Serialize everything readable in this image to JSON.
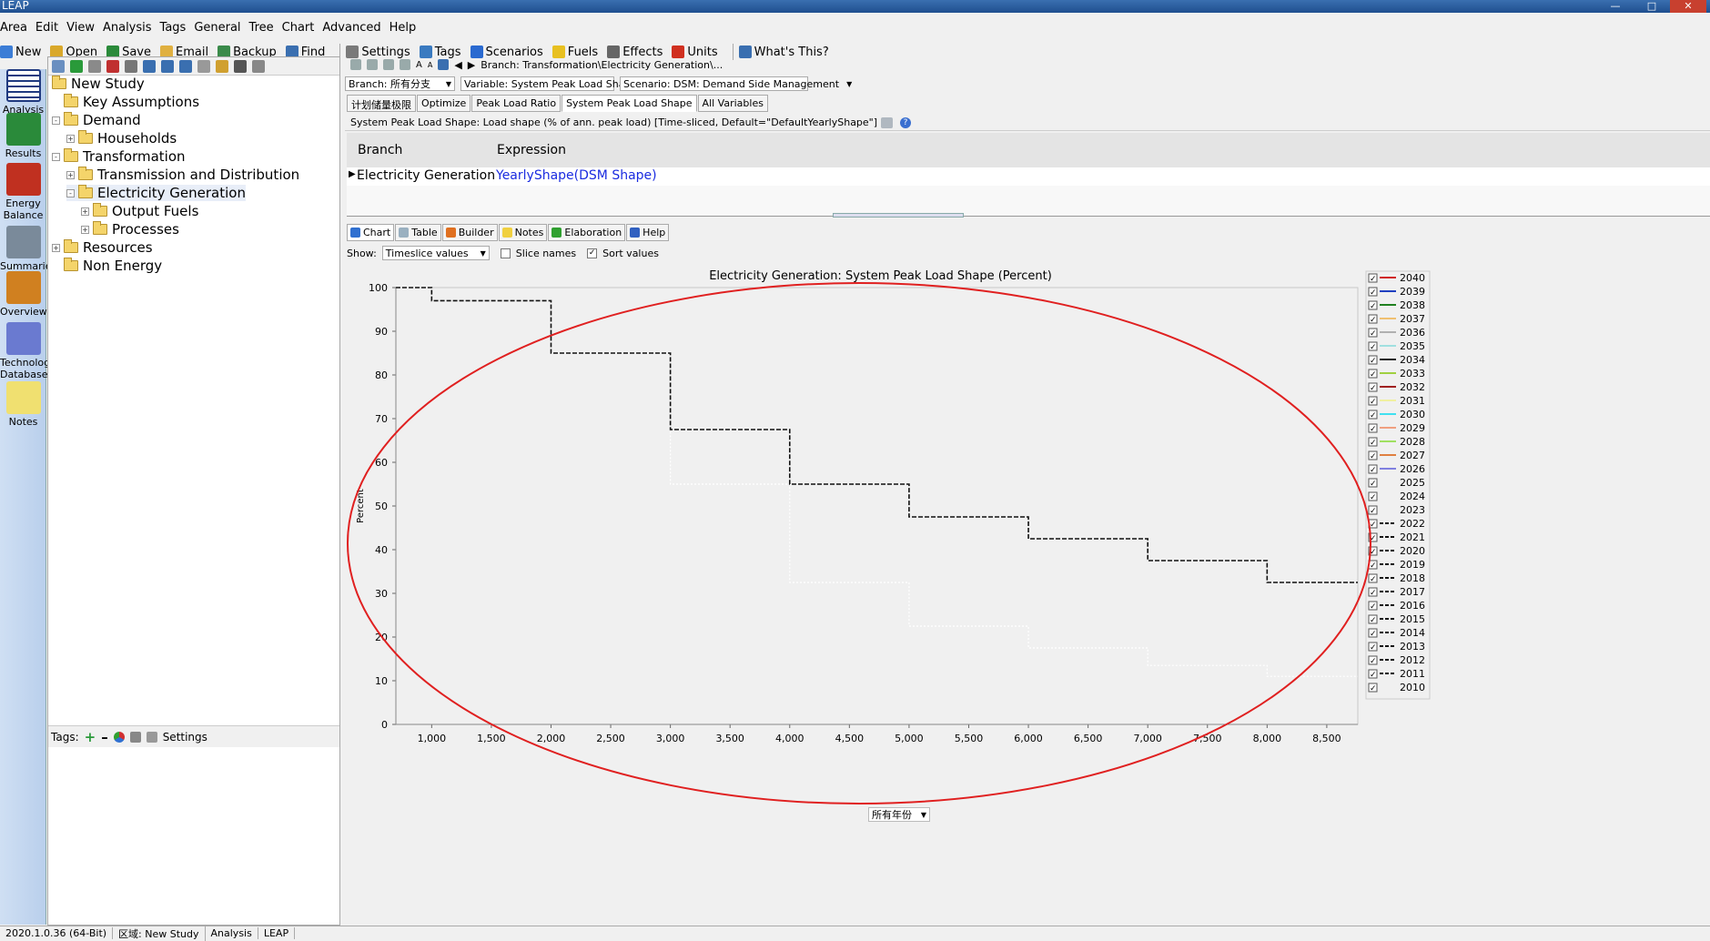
{
  "window": {
    "title": "LEAP"
  },
  "menu": [
    "Area",
    "Edit",
    "View",
    "Analysis",
    "Tags",
    "General",
    "Tree",
    "Chart",
    "Advanced",
    "Help"
  ],
  "toolbar": [
    {
      "label": "New",
      "icon": "new-icon",
      "color": "#3c7dd6"
    },
    {
      "label": "Open",
      "icon": "open-icon",
      "color": "#d9a82a"
    },
    {
      "label": "Save",
      "icon": "save-icon",
      "color": "#2a8a3a"
    },
    {
      "label": "Email",
      "icon": "email-icon",
      "color": "#e0b040"
    },
    {
      "label": "Backup",
      "icon": "backup-icon",
      "color": "#3a8a4a"
    },
    {
      "label": "Find",
      "icon": "find-icon",
      "color": "#3a6fb0"
    },
    {
      "label": "Settings",
      "icon": "settings-icon",
      "color": "#7a7a7a"
    },
    {
      "label": "Tags",
      "icon": "tags-icon",
      "color": "#3a7ac0"
    },
    {
      "label": "Scenarios",
      "icon": "scenarios-icon",
      "color": "#2a6ad0"
    },
    {
      "label": "Fuels",
      "icon": "fuels-icon",
      "color": "#e8c020"
    },
    {
      "label": "Effects",
      "icon": "effects-icon",
      "color": "#666666"
    },
    {
      "label": "Units",
      "icon": "units-icon",
      "color": "#d03020"
    },
    {
      "label": "What's This?",
      "icon": "help-icon",
      "color": "#3a6fb0"
    }
  ],
  "nav": [
    {
      "label": "Analysis",
      "icon": "analysis-icon",
      "color": "#203a80"
    },
    {
      "label": "Results",
      "icon": "results-icon",
      "color": "#2a8a3a"
    },
    {
      "label": "Energy Balance",
      "icon": "energy-balance-icon",
      "color": "#c03020"
    },
    {
      "label": "Summaries",
      "icon": "summaries-icon",
      "color": "#7a8a9a"
    },
    {
      "label": "Overviews",
      "icon": "overviews-icon",
      "color": "#d08020"
    },
    {
      "label": "Technology Database",
      "icon": "technology-database-icon",
      "color": "#6a7ad0"
    },
    {
      "label": "Notes",
      "icon": "notes-icon",
      "color": "#f0e070"
    }
  ],
  "tree": [
    {
      "label": "New Study",
      "level": 0,
      "expander": ""
    },
    {
      "label": "Key Assumptions",
      "level": 1,
      "expander": ""
    },
    {
      "label": "Demand",
      "level": 1,
      "expander": "-"
    },
    {
      "label": "Households",
      "level": 2,
      "expander": "+"
    },
    {
      "label": "Transformation",
      "level": 1,
      "expander": "-"
    },
    {
      "label": "Transmission and Distribution",
      "level": 2,
      "expander": "+"
    },
    {
      "label": "Electricity Generation",
      "level": 2,
      "expander": "-",
      "selected": true
    },
    {
      "label": "Output Fuels",
      "level": 3,
      "expander": "+"
    },
    {
      "label": "Processes",
      "level": 3,
      "expander": "+"
    },
    {
      "label": "Resources",
      "level": 1,
      "expander": "+"
    },
    {
      "label": "Non Energy",
      "level": 1,
      "expander": ""
    }
  ],
  "tags_bar": {
    "label": "Tags:",
    "settings": "Settings"
  },
  "branch_path": "Branch: Transformation\\Electricity Generation\\...",
  "selectors": {
    "branch": "Branch: 所有分支",
    "variable": "Variable: System Peak Load Shape",
    "scenario": "Scenario: DSM: Demand Side Management"
  },
  "var_tabs": [
    "计划储量极限",
    "Optimize",
    "Peak Load Ratio",
    "System Peak Load Shape",
    "All Variables"
  ],
  "var_description": "System Peak Load Shape: Load shape (% of ann. peak load) [Time-sliced, Default=\"DefaultYearlyShape\"]",
  "expr_table": {
    "col_branch": "Branch",
    "col_expression": "Expression",
    "row_branch": "Electricity Generation",
    "row_expression": "YearlyShape(DSM Shape)"
  },
  "bottom_tabs": [
    "Chart",
    "Table",
    "Builder",
    "Notes",
    "Elaboration",
    "Help"
  ],
  "show": {
    "label": "Show:",
    "value": "Timeslice values",
    "slice_names": "Slice names",
    "sort_values": "Sort values"
  },
  "year_selector": "所有年份",
  "status": [
    "2020.1.0.36 (64-Bit)",
    "区域: New Study",
    "Analysis",
    "LEAP"
  ],
  "chart_data": {
    "type": "line",
    "title": "Electricity Generation: System Peak Load Shape (Percent)",
    "ylabel": "Percent",
    "xlim": [
      700,
      8760
    ],
    "ylim": [
      0,
      100
    ],
    "xticks": [
      1000,
      1500,
      2000,
      2500,
      3000,
      3500,
      4000,
      4500,
      5000,
      5500,
      6000,
      6500,
      7000,
      7500,
      8000,
      8500
    ],
    "xtick_labels": [
      "1,000",
      "1,500",
      "2,000",
      "2,500",
      "3,000",
      "3,500",
      "4,000",
      "4,500",
      "5,000",
      "5,500",
      "6,000",
      "6,500",
      "7,000",
      "7,500",
      "8,000",
      "8,500"
    ],
    "yticks": [
      0,
      10,
      20,
      30,
      40,
      50,
      60,
      70,
      80,
      90,
      100
    ],
    "series": [
      {
        "name": "2022",
        "style": "dashed",
        "color": "#111111",
        "x": [
          700,
          1000,
          1000,
          2000,
          2000,
          3000,
          3000,
          4000,
          4000,
          5000,
          5000,
          6000,
          6000,
          7000,
          7000,
          8000,
          8000,
          8760
        ],
        "values": [
          100,
          100,
          97,
          97,
          85,
          85,
          67.5,
          67.5,
          55,
          55,
          47.5,
          47.5,
          42.5,
          42.5,
          37.5,
          37.5,
          32.5,
          32.5
        ]
      },
      {
        "name": "2023",
        "style": "dotted",
        "color": "#ffffff",
        "x": [
          700,
          1000,
          1000,
          2000,
          2000,
          3000,
          3000,
          4000,
          4000,
          5000,
          5000,
          6000,
          6000,
          7000,
          7000,
          8000,
          8000,
          8760
        ],
        "values": [
          100,
          100,
          97,
          97,
          85,
          85,
          55,
          55,
          32.5,
          32.5,
          22.5,
          22.5,
          17.5,
          17.5,
          13.5,
          13.5,
          11,
          11
        ]
      }
    ],
    "legend": {
      "placement": "right",
      "entries": [
        {
          "year": "2040",
          "color": "#d02020",
          "style": "solid",
          "checked": true
        },
        {
          "year": "2039",
          "color": "#2040c0",
          "style": "solid",
          "checked": true
        },
        {
          "year": "2038",
          "color": "#208020",
          "style": "solid",
          "checked": true
        },
        {
          "year": "2037",
          "color": "#f0c070",
          "style": "solid",
          "checked": true
        },
        {
          "year": "2036",
          "color": "#b0b0b0",
          "style": "solid",
          "checked": true
        },
        {
          "year": "2035",
          "color": "#a0e0e0",
          "style": "solid",
          "checked": true
        },
        {
          "year": "2034",
          "color": "#202020",
          "style": "solid",
          "checked": true
        },
        {
          "year": "2033",
          "color": "#a0d040",
          "style": "solid",
          "checked": true
        },
        {
          "year": "2032",
          "color": "#a02020",
          "style": "solid",
          "checked": true
        },
        {
          "year": "2031",
          "color": "#f0f0a0",
          "style": "solid",
          "checked": true
        },
        {
          "year": "2030",
          "color": "#40e0f0",
          "style": "solid",
          "checked": true
        },
        {
          "year": "2029",
          "color": "#f0a080",
          "style": "solid",
          "checked": true
        },
        {
          "year": "2028",
          "color": "#a0e060",
          "style": "solid",
          "checked": true
        },
        {
          "year": "2027",
          "color": "#e08040",
          "style": "solid",
          "checked": true
        },
        {
          "year": "2026",
          "color": "#8080e0",
          "style": "solid",
          "checked": true
        },
        {
          "year": "2025",
          "color": "#f0f0f0",
          "style": "solid",
          "checked": true
        },
        {
          "year": "2024",
          "color": "#f0f0f0",
          "style": "solid",
          "checked": true
        },
        {
          "year": "2023",
          "color": "#f0f0f0",
          "style": "solid",
          "checked": true
        },
        {
          "year": "2022",
          "color": "#111111",
          "style": "dashed",
          "checked": true
        },
        {
          "year": "2021",
          "color": "#111111",
          "style": "dashed",
          "checked": true
        },
        {
          "year": "2020",
          "color": "#111111",
          "style": "dashed",
          "checked": true
        },
        {
          "year": "2019",
          "color": "#111111",
          "style": "dashed",
          "checked": true
        },
        {
          "year": "2018",
          "color": "#111111",
          "style": "dashed",
          "checked": true
        },
        {
          "year": "2017",
          "color": "#111111",
          "style": "dashed",
          "checked": true
        },
        {
          "year": "2016",
          "color": "#111111",
          "style": "dashed",
          "checked": true
        },
        {
          "year": "2015",
          "color": "#111111",
          "style": "dashed",
          "checked": true
        },
        {
          "year": "2014",
          "color": "#111111",
          "style": "dashed",
          "checked": true
        },
        {
          "year": "2013",
          "color": "#111111",
          "style": "dashed",
          "checked": true
        },
        {
          "year": "2012",
          "color": "#111111",
          "style": "dashed",
          "checked": true
        },
        {
          "year": "2011",
          "color": "#111111",
          "style": "dashed",
          "checked": true
        },
        {
          "year": "2010",
          "color": "#f0f0f0",
          "style": "solid",
          "checked": true
        }
      ]
    },
    "annotation": {
      "shape": "ellipse",
      "color": "#e02020"
    }
  }
}
